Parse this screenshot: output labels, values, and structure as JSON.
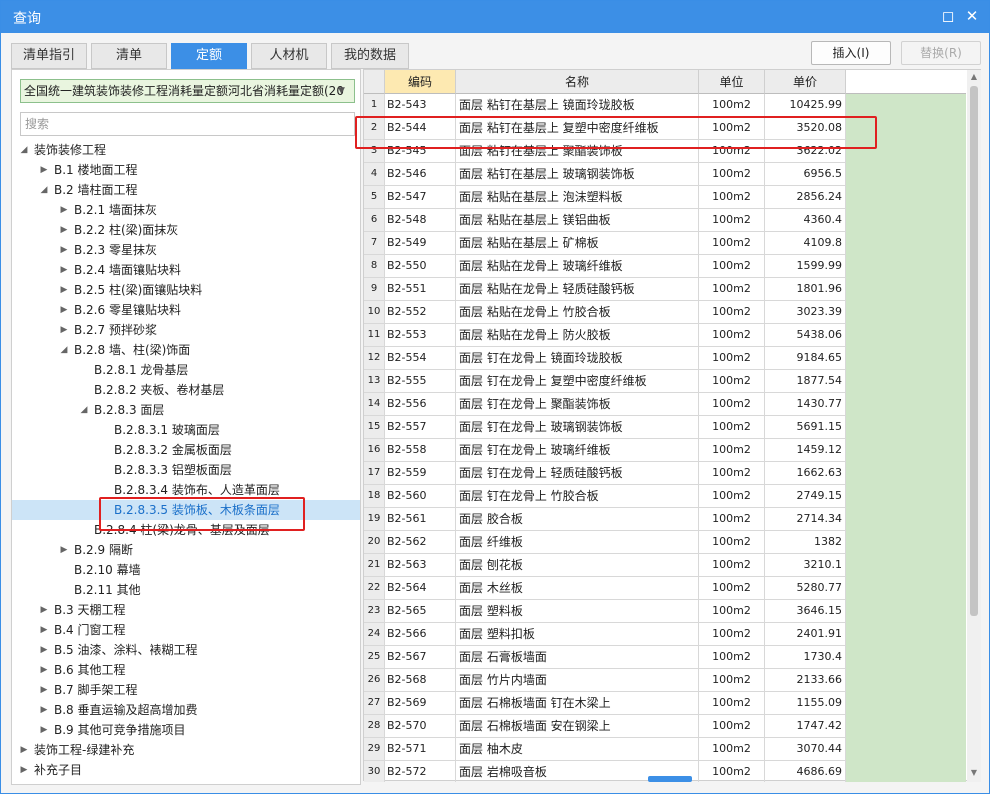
{
  "window": {
    "title": "查询"
  },
  "tabs": [
    "清单指引",
    "清单",
    "定额",
    "人材机",
    "我的数据"
  ],
  "active_tab": "定额",
  "toolbar": {
    "insert": "插入(I)",
    "replace": "替换(R)"
  },
  "dropdown": {
    "value": "全国统一建筑装饰装修工程消耗量定额河北省消耗量定额(20"
  },
  "search": {
    "placeholder": "搜索"
  },
  "tree": [
    {
      "label": "装饰装修工程",
      "level": 0,
      "toggle": "expanded"
    },
    {
      "label": "B.1 楼地面工程",
      "level": 1,
      "toggle": "collapsed"
    },
    {
      "label": "B.2 墙柱面工程",
      "level": 1,
      "toggle": "expanded"
    },
    {
      "label": "B.2.1 墙面抹灰",
      "level": 2,
      "toggle": "collapsed"
    },
    {
      "label": "B.2.2 柱(梁)面抹灰",
      "level": 2,
      "toggle": "collapsed"
    },
    {
      "label": "B.2.3 零星抹灰",
      "level": 2,
      "toggle": "collapsed"
    },
    {
      "label": "B.2.4 墙面镶贴块料",
      "level": 2,
      "toggle": "collapsed"
    },
    {
      "label": "B.2.5 柱(梁)面镶贴块料",
      "level": 2,
      "toggle": "collapsed"
    },
    {
      "label": "B.2.6 零星镶贴块料",
      "level": 2,
      "toggle": "collapsed"
    },
    {
      "label": "B.2.7 预拌砂浆",
      "level": 2,
      "toggle": "collapsed"
    },
    {
      "label": "B.2.8 墙、柱(梁)饰面",
      "level": 2,
      "toggle": "expanded"
    },
    {
      "label": "B.2.8.1 龙骨基层",
      "level": 3,
      "toggle": "none"
    },
    {
      "label": "B.2.8.2 夹板、卷材基层",
      "level": 3,
      "toggle": "none"
    },
    {
      "label": "B.2.8.3 面层",
      "level": 3,
      "toggle": "expanded"
    },
    {
      "label": "B.2.8.3.1 玻璃面层",
      "level": 4,
      "toggle": "none"
    },
    {
      "label": "B.2.8.3.2 金属板面层",
      "level": 4,
      "toggle": "none"
    },
    {
      "label": "B.2.8.3.3 铝塑板面层",
      "level": 4,
      "toggle": "none"
    },
    {
      "label": "B.2.8.3.4 装饰布、人造革面层",
      "level": 4,
      "toggle": "none"
    },
    {
      "label": "B.2.8.3.5 装饰板、木板条面层",
      "level": 4,
      "toggle": "none",
      "selected": true
    },
    {
      "label": "B.2.8.4 柱(梁)龙骨、基层及面层",
      "level": 3,
      "toggle": "none"
    },
    {
      "label": "B.2.9 隔断",
      "level": 2,
      "toggle": "collapsed"
    },
    {
      "label": "B.2.10 幕墙",
      "level": 2,
      "toggle": "none"
    },
    {
      "label": "B.2.11 其他",
      "level": 2,
      "toggle": "none"
    },
    {
      "label": "B.3 天棚工程",
      "level": 1,
      "toggle": "collapsed"
    },
    {
      "label": "B.4 门窗工程",
      "level": 1,
      "toggle": "collapsed"
    },
    {
      "label": "B.5 油漆、涂料、裱糊工程",
      "level": 1,
      "toggle": "collapsed"
    },
    {
      "label": "B.6 其他工程",
      "level": 1,
      "toggle": "collapsed"
    },
    {
      "label": "B.7 脚手架工程",
      "level": 1,
      "toggle": "collapsed"
    },
    {
      "label": "B.8 垂直运输及超高增加费",
      "level": 1,
      "toggle": "collapsed"
    },
    {
      "label": "B.9 其他可竞争措施项目",
      "level": 1,
      "toggle": "collapsed"
    },
    {
      "label": "装饰工程-绿建补充",
      "level": 0,
      "toggle": "collapsed"
    },
    {
      "label": "补充子目",
      "level": 0,
      "toggle": "collapsed"
    }
  ],
  "table": {
    "headers": {
      "code": "编码",
      "name": "名称",
      "unit": "单位",
      "price": "单价"
    },
    "rows": [
      {
        "n": "1",
        "code": "B2-543",
        "name": "面层 粘钉在基层上 镜面玲珑胶板",
        "unit": "100m2",
        "price": "10425.99"
      },
      {
        "n": "2",
        "code": "B2-544",
        "name": "面层 粘钉在基层上 复塑中密度纤维板",
        "unit": "100m2",
        "price": "3520.08"
      },
      {
        "n": "3",
        "code": "B2-545",
        "name": "面层 粘钉在基层上 聚酯装饰板",
        "unit": "100m2",
        "price": "3622.02"
      },
      {
        "n": "4",
        "code": "B2-546",
        "name": "面层 粘钉在基层上 玻璃钢装饰板",
        "unit": "100m2",
        "price": "6956.5"
      },
      {
        "n": "5",
        "code": "B2-547",
        "name": "面层 粘贴在基层上 泡沫塑料板",
        "unit": "100m2",
        "price": "2856.24"
      },
      {
        "n": "6",
        "code": "B2-548",
        "name": "面层 粘贴在基层上 镁铝曲板",
        "unit": "100m2",
        "price": "4360.4"
      },
      {
        "n": "7",
        "code": "B2-549",
        "name": "面层 粘贴在基层上 矿棉板",
        "unit": "100m2",
        "price": "4109.8"
      },
      {
        "n": "8",
        "code": "B2-550",
        "name": "面层 粘贴在龙骨上 玻璃纤维板",
        "unit": "100m2",
        "price": "1599.99"
      },
      {
        "n": "9",
        "code": "B2-551",
        "name": "面层 粘贴在龙骨上 轻质硅酸钙板",
        "unit": "100m2",
        "price": "1801.96"
      },
      {
        "n": "10",
        "code": "B2-552",
        "name": "面层 粘贴在龙骨上 竹胶合板",
        "unit": "100m2",
        "price": "3023.39"
      },
      {
        "n": "11",
        "code": "B2-553",
        "name": "面层 粘贴在龙骨上 防火胶板",
        "unit": "100m2",
        "price": "5438.06"
      },
      {
        "n": "12",
        "code": "B2-554",
        "name": "面层 钉在龙骨上 镜面玲珑胶板",
        "unit": "100m2",
        "price": "9184.65"
      },
      {
        "n": "13",
        "code": "B2-555",
        "name": "面层 钉在龙骨上 复塑中密度纤维板",
        "unit": "100m2",
        "price": "1877.54"
      },
      {
        "n": "14",
        "code": "B2-556",
        "name": "面层 钉在龙骨上 聚酯装饰板",
        "unit": "100m2",
        "price": "1430.77"
      },
      {
        "n": "15",
        "code": "B2-557",
        "name": "面层 钉在龙骨上 玻璃钢装饰板",
        "unit": "100m2",
        "price": "5691.15"
      },
      {
        "n": "16",
        "code": "B2-558",
        "name": "面层 钉在龙骨上 玻璃纤维板",
        "unit": "100m2",
        "price": "1459.12"
      },
      {
        "n": "17",
        "code": "B2-559",
        "name": "面层 钉在龙骨上 轻质硅酸钙板",
        "unit": "100m2",
        "price": "1662.63"
      },
      {
        "n": "18",
        "code": "B2-560",
        "name": "面层 钉在龙骨上 竹胶合板",
        "unit": "100m2",
        "price": "2749.15"
      },
      {
        "n": "19",
        "code": "B2-561",
        "name": "面层 胶合板",
        "unit": "100m2",
        "price": "2714.34"
      },
      {
        "n": "20",
        "code": "B2-562",
        "name": "面层 纤维板",
        "unit": "100m2",
        "price": "1382"
      },
      {
        "n": "21",
        "code": "B2-563",
        "name": "面层 刨花板",
        "unit": "100m2",
        "price": "3210.1"
      },
      {
        "n": "22",
        "code": "B2-564",
        "name": "面层 木丝板",
        "unit": "100m2",
        "price": "5280.77"
      },
      {
        "n": "23",
        "code": "B2-565",
        "name": "面层 塑料板",
        "unit": "100m2",
        "price": "3646.15"
      },
      {
        "n": "24",
        "code": "B2-566",
        "name": "面层 塑料扣板",
        "unit": "100m2",
        "price": "2401.91"
      },
      {
        "n": "25",
        "code": "B2-567",
        "name": "面层 石膏板墙面",
        "unit": "100m2",
        "price": "1730.4"
      },
      {
        "n": "26",
        "code": "B2-568",
        "name": "面层 竹片内墙面",
        "unit": "100m2",
        "price": "2133.66"
      },
      {
        "n": "27",
        "code": "B2-569",
        "name": "面层 石棉板墙面 钉在木梁上",
        "unit": "100m2",
        "price": "1155.09"
      },
      {
        "n": "28",
        "code": "B2-570",
        "name": "面层 石棉板墙面 安在钢梁上",
        "unit": "100m2",
        "price": "1747.42"
      },
      {
        "n": "29",
        "code": "B2-571",
        "name": "面层 柚木皮",
        "unit": "100m2",
        "price": "3070.44"
      },
      {
        "n": "30",
        "code": "B2-572",
        "name": "面层 岩棉吸音板",
        "unit": "100m2",
        "price": "4686.69"
      }
    ]
  },
  "colors": {
    "accent": "#3c8fe6",
    "highlight_box": "#e02020",
    "green_fill": "#cfe6c8",
    "selected_row": "#cce4f7"
  }
}
